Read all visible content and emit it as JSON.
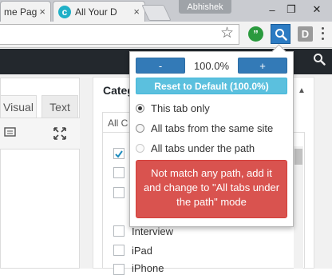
{
  "browser": {
    "tabs": [
      {
        "title": "me Pag"
      },
      {
        "title": "All Your D"
      }
    ],
    "profile_name": "Abhishek",
    "window_controls": {
      "minimize": "–",
      "restore": "❐",
      "close": "✕"
    }
  },
  "page": {
    "editor_tabs": {
      "visual": "Visual",
      "text": "Text"
    },
    "categories": {
      "title": "Categ",
      "tab_label": "All C",
      "items": [
        {
          "label": "",
          "checked": true
        },
        {
          "label": "",
          "checked": false
        },
        {
          "label": "",
          "checked": false
        },
        {
          "label": "",
          "checked": false
        },
        {
          "label": "Interview",
          "checked": false
        },
        {
          "label": "iPad",
          "checked": false
        },
        {
          "label": "iPhone",
          "checked": false
        }
      ]
    }
  },
  "zoom_popup": {
    "minus_label": "-",
    "plus_label": "+",
    "zoom_value": "100.0%",
    "reset_label": "Reset to Default (100.0%)",
    "options": [
      {
        "label": "This tab only",
        "selected": true,
        "disabled": false
      },
      {
        "label": "All tabs from the same site",
        "selected": false,
        "disabled": false
      },
      {
        "label": "All tabs under the path",
        "selected": false,
        "disabled": true
      }
    ],
    "alert_text": "Not match any path, add it and change to \"All tabs under the path\" mode"
  },
  "colors": {
    "primary": "#337ab7",
    "info": "#5bc0de",
    "danger": "#d9534f",
    "wp_admin_bar": "#23282d"
  }
}
